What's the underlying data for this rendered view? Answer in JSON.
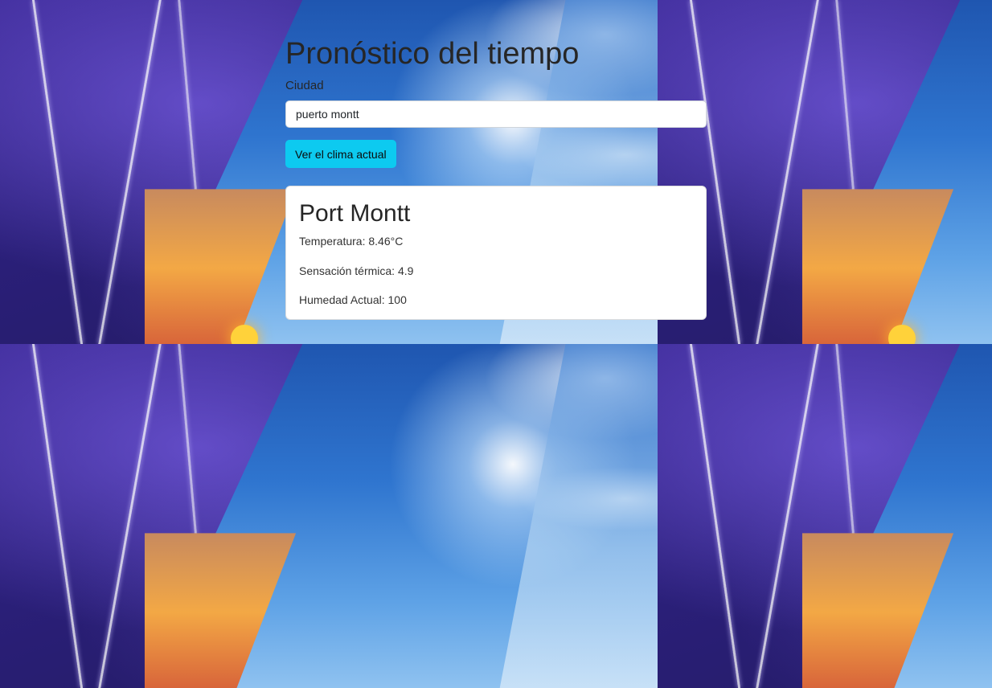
{
  "header": {
    "title": "Pronóstico del tiempo"
  },
  "form": {
    "city_label": "Ciudad",
    "city_value": "puerto montt",
    "submit_label": "Ver el clima actual"
  },
  "weather_card": {
    "city": "Port Montt",
    "temperature": "Temperatura: 8.46°C",
    "feels_like": "Sensación térmica: 4.9",
    "humidity": "Humedad Actual: 100"
  },
  "colors": {
    "button_bg": "#0dcaf0",
    "card_bg": "#ffffff",
    "title_text": "#262626"
  }
}
